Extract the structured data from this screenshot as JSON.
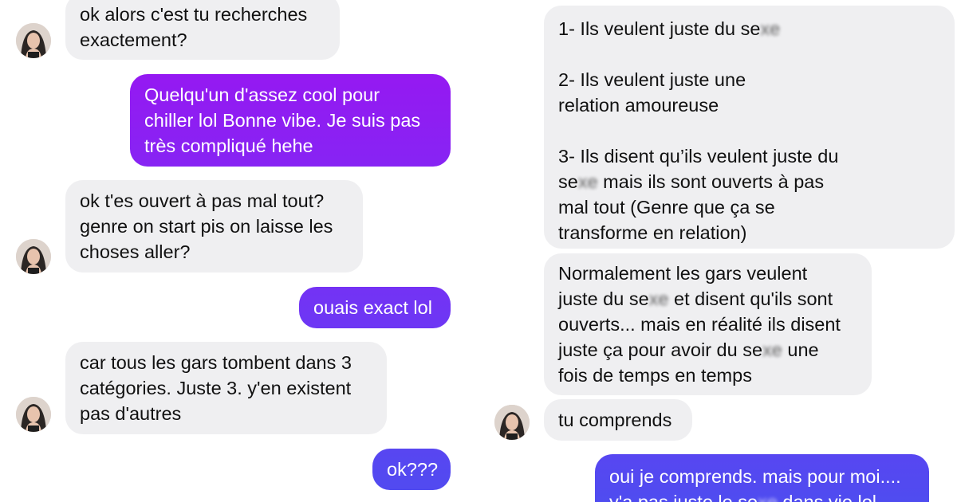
{
  "colors": {
    "received_bubble": "#efeff1",
    "received_text": "#111111",
    "sent_top": "#a010f0",
    "sent_mid": "#7a2ef5",
    "sent_bottom": "#4f4cf0",
    "sent_text": "#ffffff"
  },
  "left_thread": {
    "messages": [
      {
        "from": "them",
        "text": "ok alors c'est tu recherches\nexactement?"
      },
      {
        "from": "me",
        "text": "Quelqu'un d'assez cool pour\nchiller lol Bonne vibe. Je suis pas\ntrès compliqué hehe"
      },
      {
        "from": "them",
        "text": "ok t'es ouvert à pas mal tout?\ngenre on start pis on laisse les\nchoses aller?"
      },
      {
        "from": "me",
        "text": "ouais exact lol"
      },
      {
        "from": "them",
        "text": "car tous les gars tombent dans 3\ncatégories. Juste 3. y'en existent\npas d'autres"
      },
      {
        "from": "me",
        "text": "ok???"
      }
    ]
  },
  "right_thread": {
    "messages": [
      {
        "from": "them",
        "parts": [
          {
            "text": "1- Ils veulent juste du se"
          },
          {
            "text": "xe",
            "blurred": true
          },
          {
            "text": "\n\n2- Ils veulent juste une\nrelation amoureuse\n\n3- Ils disent qu’ils veulent juste du\nse"
          },
          {
            "text": "xe",
            "blurred": true
          },
          {
            "text": " mais ils sont ouverts à pas\nmal tout (Genre que ça se\ntransforme en relation)"
          }
        ]
      },
      {
        "from": "them",
        "parts": [
          {
            "text": "Normalement les gars veulent\njuste du se"
          },
          {
            "text": "xe",
            "blurred": true
          },
          {
            "text": " et disent qu'ils sont\nouverts... mais en réalité ils disent\njuste ça pour avoir du se"
          },
          {
            "text": "xe",
            "blurred": true
          },
          {
            "text": " une\nfois de temps en temps"
          }
        ]
      },
      {
        "from": "them",
        "parts": [
          {
            "text": "tu comprends"
          }
        ]
      },
      {
        "from": "me",
        "parts": [
          {
            "text": "oui je comprends. mais pour moi....\ny'a pas juste le se"
          },
          {
            "text": "xe",
            "blurred": true
          },
          {
            "text": " dans vie lol"
          }
        ]
      }
    ]
  }
}
